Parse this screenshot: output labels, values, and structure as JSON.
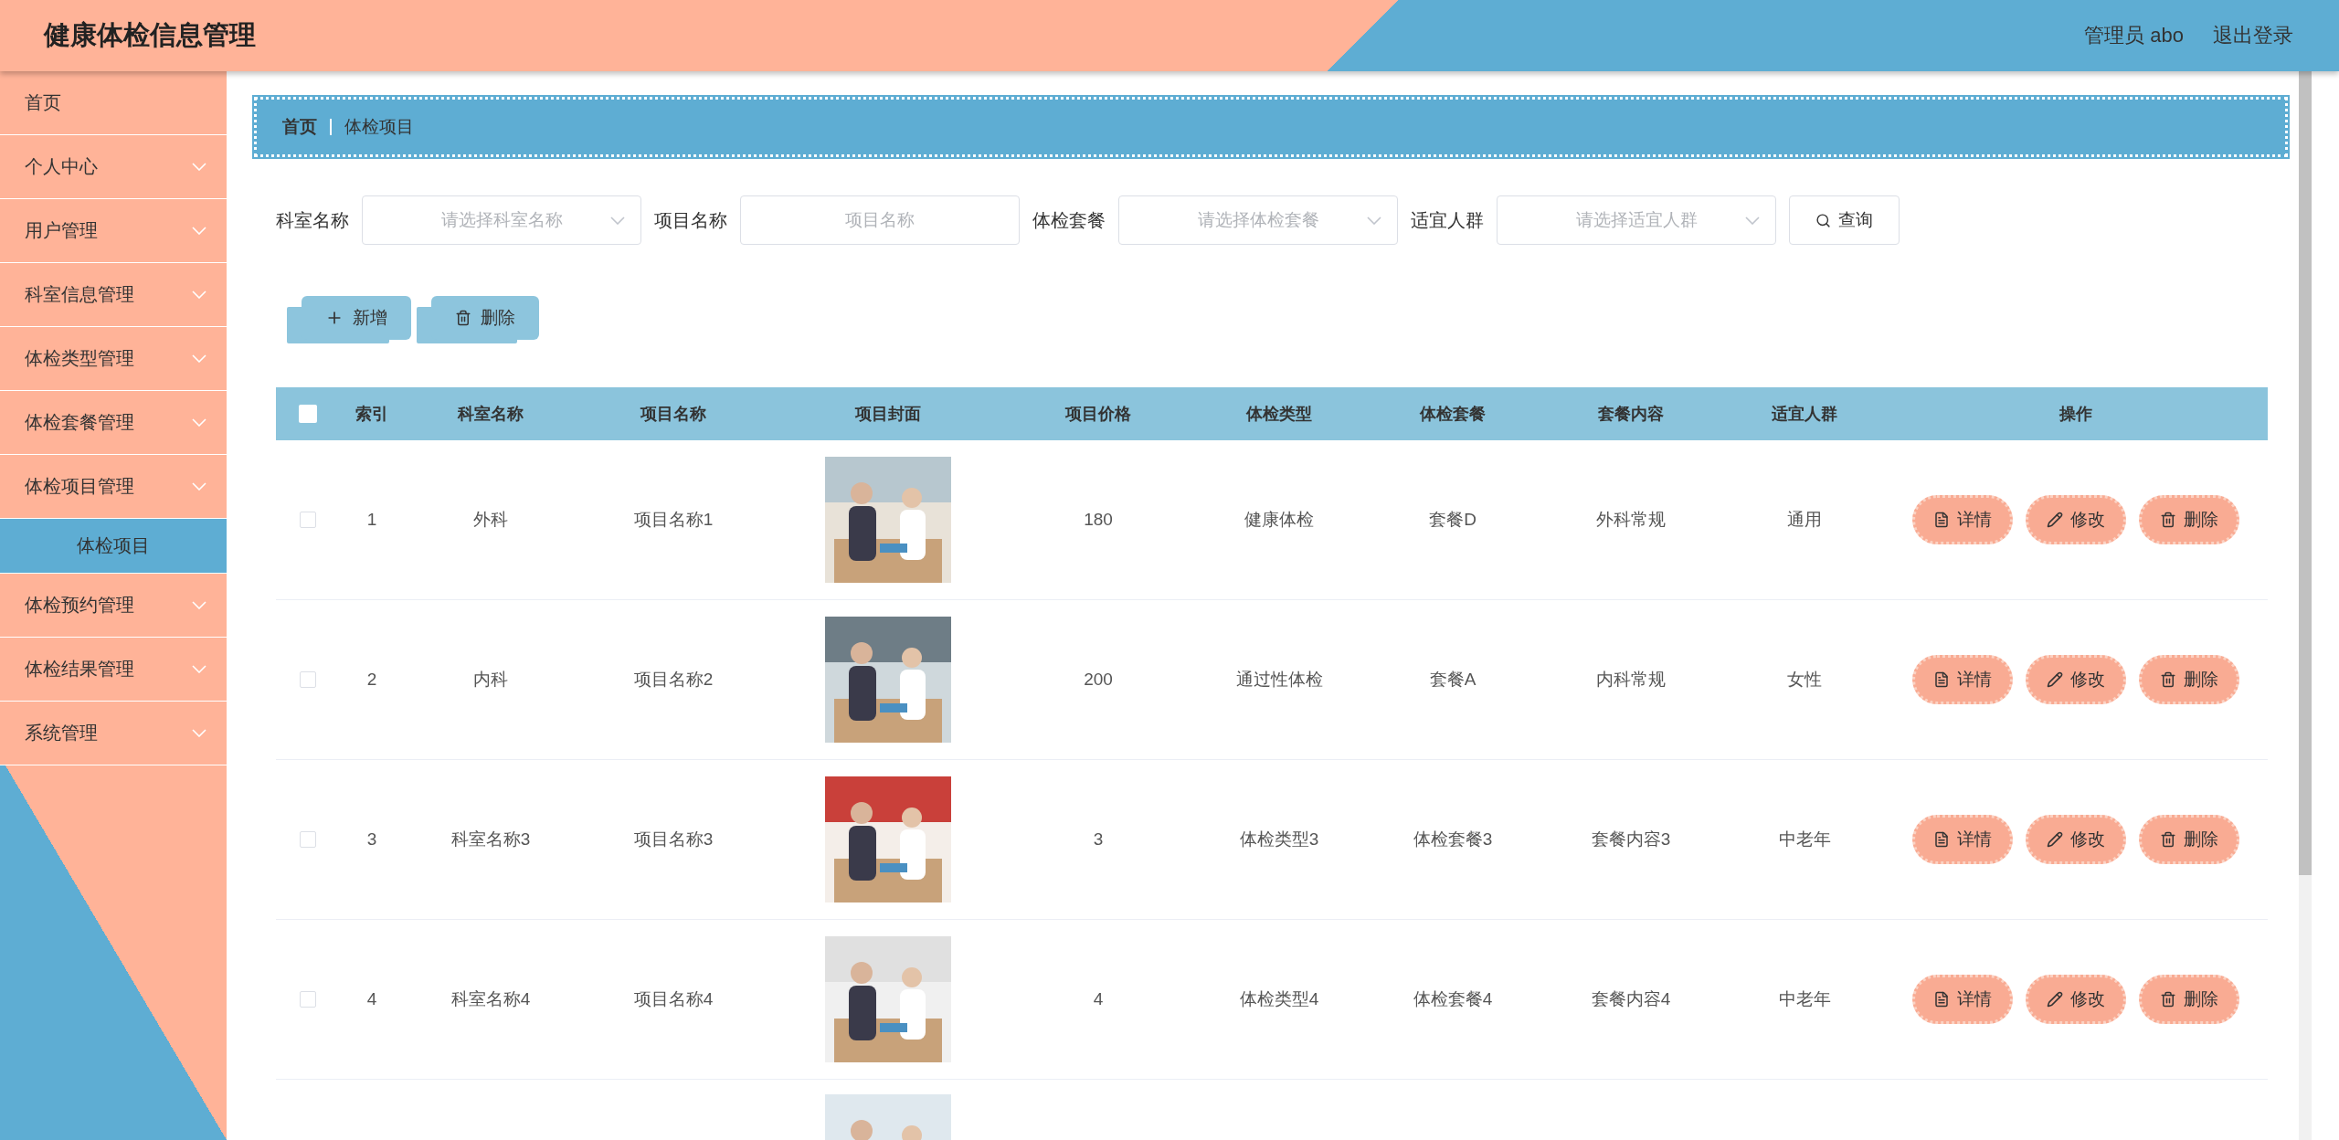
{
  "header": {
    "title": "健康体检信息管理",
    "user": "管理员 abo",
    "logout": "退出登录"
  },
  "sidebar": {
    "items": [
      {
        "label": "首页",
        "kind": "link",
        "selected": false
      },
      {
        "label": "个人中心",
        "kind": "menu",
        "selected": false
      },
      {
        "label": "用户管理",
        "kind": "menu",
        "selected": false
      },
      {
        "label": "科室信息管理",
        "kind": "menu",
        "selected": false
      },
      {
        "label": "体检类型管理",
        "kind": "menu",
        "selected": false
      },
      {
        "label": "体检套餐管理",
        "kind": "menu",
        "selected": false
      },
      {
        "label": "体检项目管理",
        "kind": "menu",
        "selected": false,
        "children": [
          {
            "label": "体检项目",
            "selected": true
          }
        ]
      },
      {
        "label": "体检预约管理",
        "kind": "menu",
        "selected": false
      },
      {
        "label": "体检结果管理",
        "kind": "menu",
        "selected": false
      },
      {
        "label": "系统管理",
        "kind": "menu",
        "selected": false
      }
    ]
  },
  "breadcrumb": [
    "首页",
    "体检项目"
  ],
  "filters": [
    {
      "label": "科室名称",
      "kind": "select",
      "placeholder": "请选择科室名称"
    },
    {
      "label": "项目名称",
      "kind": "input",
      "placeholder": "项目名称"
    },
    {
      "label": "体检套餐",
      "kind": "select",
      "placeholder": "请选择体检套餐"
    },
    {
      "label": "适宜人群",
      "kind": "select",
      "placeholder": "请选择适宜人群"
    }
  ],
  "search_button": "查询",
  "toolbar": [
    {
      "label": "新增",
      "kind": "add"
    },
    {
      "label": "删除",
      "kind": "delete"
    }
  ],
  "table": {
    "all_checked": false,
    "columns": [
      "索引",
      "科室名称",
      "项目名称",
      "项目封面",
      "项目价格",
      "体检类型",
      "体检套餐",
      "套餐内容",
      "适宜人群",
      "操作"
    ],
    "rows": [
      {
        "checked": false,
        "cells": [
          "1",
          "外科",
          "项目名称1",
          "180",
          "健康体检",
          "套餐D",
          "外科常规",
          "通用"
        ],
        "cover": {
          "kind": "picture"
        },
        "actions": [
          {
            "label": "详情",
            "kind": "detail"
          },
          {
            "label": "修改",
            "kind": "edit"
          },
          {
            "label": "删除",
            "kind": "delete"
          }
        ]
      },
      {
        "checked": false,
        "cells": [
          "2",
          "内科",
          "项目名称2",
          "200",
          "通过性体检",
          "套餐A",
          "内科常规",
          "女性"
        ],
        "cover": {
          "kind": "picture"
        },
        "actions": [
          {
            "label": "详情",
            "kind": "detail"
          },
          {
            "label": "修改",
            "kind": "edit"
          },
          {
            "label": "删除",
            "kind": "delete"
          }
        ]
      },
      {
        "checked": false,
        "cells": [
          "3",
          "科室名称3",
          "项目名称3",
          "3",
          "体检类型3",
          "体检套餐3",
          "套餐内容3",
          "中老年"
        ],
        "cover": {
          "kind": "picture"
        },
        "actions": [
          {
            "label": "详情",
            "kind": "detail"
          },
          {
            "label": "修改",
            "kind": "edit"
          },
          {
            "label": "删除",
            "kind": "delete"
          }
        ]
      },
      {
        "checked": false,
        "cells": [
          "4",
          "科室名称4",
          "项目名称4",
          "4",
          "体检类型4",
          "体检套餐4",
          "套餐内容4",
          "中老年"
        ],
        "cover": {
          "kind": "picture"
        },
        "actions": [
          {
            "label": "详情",
            "kind": "detail"
          },
          {
            "label": "修改",
            "kind": "edit"
          },
          {
            "label": "删除",
            "kind": "delete"
          }
        ]
      },
      {
        "partial": true,
        "cover": {
          "kind": "picture"
        }
      }
    ]
  }
}
